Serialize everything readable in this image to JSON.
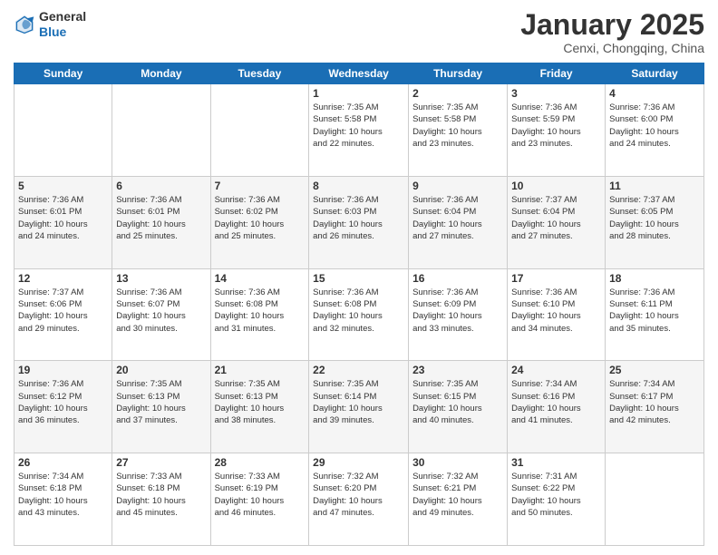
{
  "header": {
    "logo_general": "General",
    "logo_blue": "Blue",
    "title": "January 2025",
    "subtitle": "Cenxi, Chongqing, China"
  },
  "weekdays": [
    "Sunday",
    "Monday",
    "Tuesday",
    "Wednesday",
    "Thursday",
    "Friday",
    "Saturday"
  ],
  "weeks": [
    [
      {
        "day": "",
        "info": ""
      },
      {
        "day": "",
        "info": ""
      },
      {
        "day": "",
        "info": ""
      },
      {
        "day": "1",
        "info": "Sunrise: 7:35 AM\nSunset: 5:58 PM\nDaylight: 10 hours\nand 22 minutes."
      },
      {
        "day": "2",
        "info": "Sunrise: 7:35 AM\nSunset: 5:58 PM\nDaylight: 10 hours\nand 23 minutes."
      },
      {
        "day": "3",
        "info": "Sunrise: 7:36 AM\nSunset: 5:59 PM\nDaylight: 10 hours\nand 23 minutes."
      },
      {
        "day": "4",
        "info": "Sunrise: 7:36 AM\nSunset: 6:00 PM\nDaylight: 10 hours\nand 24 minutes."
      }
    ],
    [
      {
        "day": "5",
        "info": "Sunrise: 7:36 AM\nSunset: 6:01 PM\nDaylight: 10 hours\nand 24 minutes."
      },
      {
        "day": "6",
        "info": "Sunrise: 7:36 AM\nSunset: 6:01 PM\nDaylight: 10 hours\nand 25 minutes."
      },
      {
        "day": "7",
        "info": "Sunrise: 7:36 AM\nSunset: 6:02 PM\nDaylight: 10 hours\nand 25 minutes."
      },
      {
        "day": "8",
        "info": "Sunrise: 7:36 AM\nSunset: 6:03 PM\nDaylight: 10 hours\nand 26 minutes."
      },
      {
        "day": "9",
        "info": "Sunrise: 7:36 AM\nSunset: 6:04 PM\nDaylight: 10 hours\nand 27 minutes."
      },
      {
        "day": "10",
        "info": "Sunrise: 7:37 AM\nSunset: 6:04 PM\nDaylight: 10 hours\nand 27 minutes."
      },
      {
        "day": "11",
        "info": "Sunrise: 7:37 AM\nSunset: 6:05 PM\nDaylight: 10 hours\nand 28 minutes."
      }
    ],
    [
      {
        "day": "12",
        "info": "Sunrise: 7:37 AM\nSunset: 6:06 PM\nDaylight: 10 hours\nand 29 minutes."
      },
      {
        "day": "13",
        "info": "Sunrise: 7:36 AM\nSunset: 6:07 PM\nDaylight: 10 hours\nand 30 minutes."
      },
      {
        "day": "14",
        "info": "Sunrise: 7:36 AM\nSunset: 6:08 PM\nDaylight: 10 hours\nand 31 minutes."
      },
      {
        "day": "15",
        "info": "Sunrise: 7:36 AM\nSunset: 6:08 PM\nDaylight: 10 hours\nand 32 minutes."
      },
      {
        "day": "16",
        "info": "Sunrise: 7:36 AM\nSunset: 6:09 PM\nDaylight: 10 hours\nand 33 minutes."
      },
      {
        "day": "17",
        "info": "Sunrise: 7:36 AM\nSunset: 6:10 PM\nDaylight: 10 hours\nand 34 minutes."
      },
      {
        "day": "18",
        "info": "Sunrise: 7:36 AM\nSunset: 6:11 PM\nDaylight: 10 hours\nand 35 minutes."
      }
    ],
    [
      {
        "day": "19",
        "info": "Sunrise: 7:36 AM\nSunset: 6:12 PM\nDaylight: 10 hours\nand 36 minutes."
      },
      {
        "day": "20",
        "info": "Sunrise: 7:35 AM\nSunset: 6:13 PM\nDaylight: 10 hours\nand 37 minutes."
      },
      {
        "day": "21",
        "info": "Sunrise: 7:35 AM\nSunset: 6:13 PM\nDaylight: 10 hours\nand 38 minutes."
      },
      {
        "day": "22",
        "info": "Sunrise: 7:35 AM\nSunset: 6:14 PM\nDaylight: 10 hours\nand 39 minutes."
      },
      {
        "day": "23",
        "info": "Sunrise: 7:35 AM\nSunset: 6:15 PM\nDaylight: 10 hours\nand 40 minutes."
      },
      {
        "day": "24",
        "info": "Sunrise: 7:34 AM\nSunset: 6:16 PM\nDaylight: 10 hours\nand 41 minutes."
      },
      {
        "day": "25",
        "info": "Sunrise: 7:34 AM\nSunset: 6:17 PM\nDaylight: 10 hours\nand 42 minutes."
      }
    ],
    [
      {
        "day": "26",
        "info": "Sunrise: 7:34 AM\nSunset: 6:18 PM\nDaylight: 10 hours\nand 43 minutes."
      },
      {
        "day": "27",
        "info": "Sunrise: 7:33 AM\nSunset: 6:18 PM\nDaylight: 10 hours\nand 45 minutes."
      },
      {
        "day": "28",
        "info": "Sunrise: 7:33 AM\nSunset: 6:19 PM\nDaylight: 10 hours\nand 46 minutes."
      },
      {
        "day": "29",
        "info": "Sunrise: 7:32 AM\nSunset: 6:20 PM\nDaylight: 10 hours\nand 47 minutes."
      },
      {
        "day": "30",
        "info": "Sunrise: 7:32 AM\nSunset: 6:21 PM\nDaylight: 10 hours\nand 49 minutes."
      },
      {
        "day": "31",
        "info": "Sunrise: 7:31 AM\nSunset: 6:22 PM\nDaylight: 10 hours\nand 50 minutes."
      },
      {
        "day": "",
        "info": ""
      }
    ]
  ]
}
